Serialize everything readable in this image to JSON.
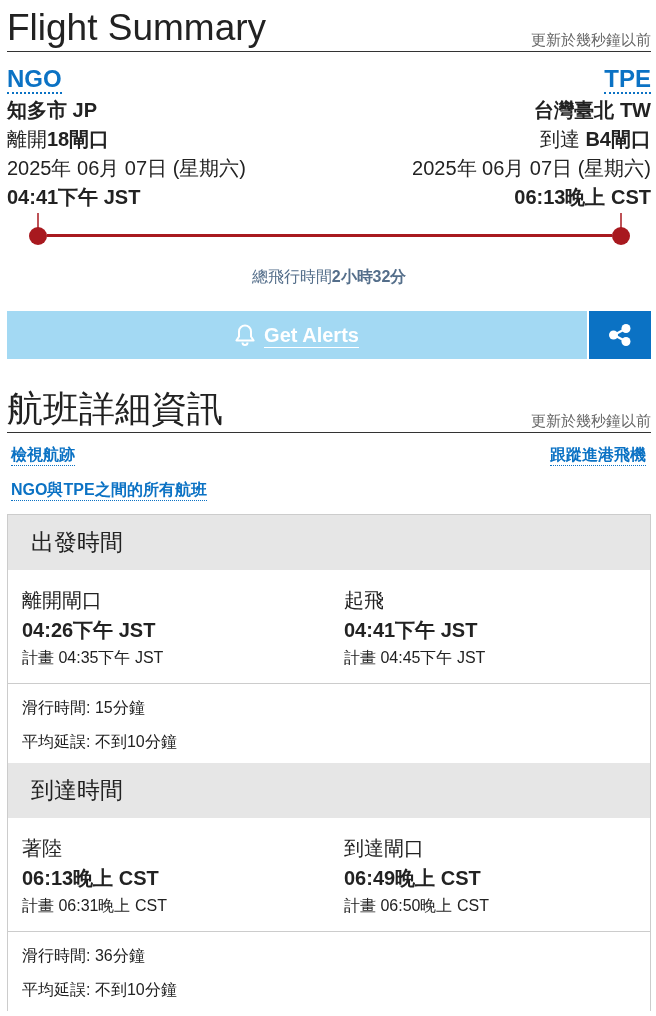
{
  "summary": {
    "title": "Flight Summary",
    "updated": "更新於幾秒鐘以前",
    "origin": {
      "code": "NGO",
      "city": "知多市 JP",
      "gate": "離開**18閘口**",
      "date": "2025年 06月 07日 (星期六)",
      "time": "04:41下午 JST"
    },
    "destination": {
      "code": "TPE",
      "city": "台灣臺北 TW",
      "gate": "到達 **B4閘口**",
      "date": "2025年 06月 07日 (星期六)",
      "time": "06:13晚上 CST"
    },
    "progress": {
      "level": 1
    },
    "duration": "總飛行時間**2小時32分**"
  },
  "actions": {
    "alerts_button": "Get Alerts"
  },
  "details": {
    "title": "航班詳細資訊",
    "updated": "更新於幾秒鐘以前",
    "links": [
      "檢視航跡",
      "跟蹤進港飛機",
      "NGO與TPE之間的所有航班"
    ],
    "sections": [
      {
        "title": "出發時間",
        "events": [
          {
            "label": "離開閘口",
            "actual": "04:26下午 JST",
            "scheduled": "計畫 04:35下午 JST"
          },
          {
            "label": "起飛",
            "actual": "04:41下午 JST",
            "scheduled": "計畫 04:45下午 JST"
          }
        ],
        "notes": [
          "滑行時間: 15分鐘",
          "平均延誤: 不到10分鐘"
        ]
      },
      {
        "title": "到達時間",
        "events": [
          {
            "label": "著陸",
            "actual": "06:13晚上 CST",
            "scheduled": "計畫 06:31晚上 CST"
          },
          {
            "label": "到達閘口",
            "actual": "06:49晚上 CST",
            "scheduled": "計畫 06:50晚上 CST"
          }
        ],
        "notes": [
          "滑行時間: 36分鐘",
          "平均延誤: 不到10分鐘"
        ]
      }
    ]
  }
}
